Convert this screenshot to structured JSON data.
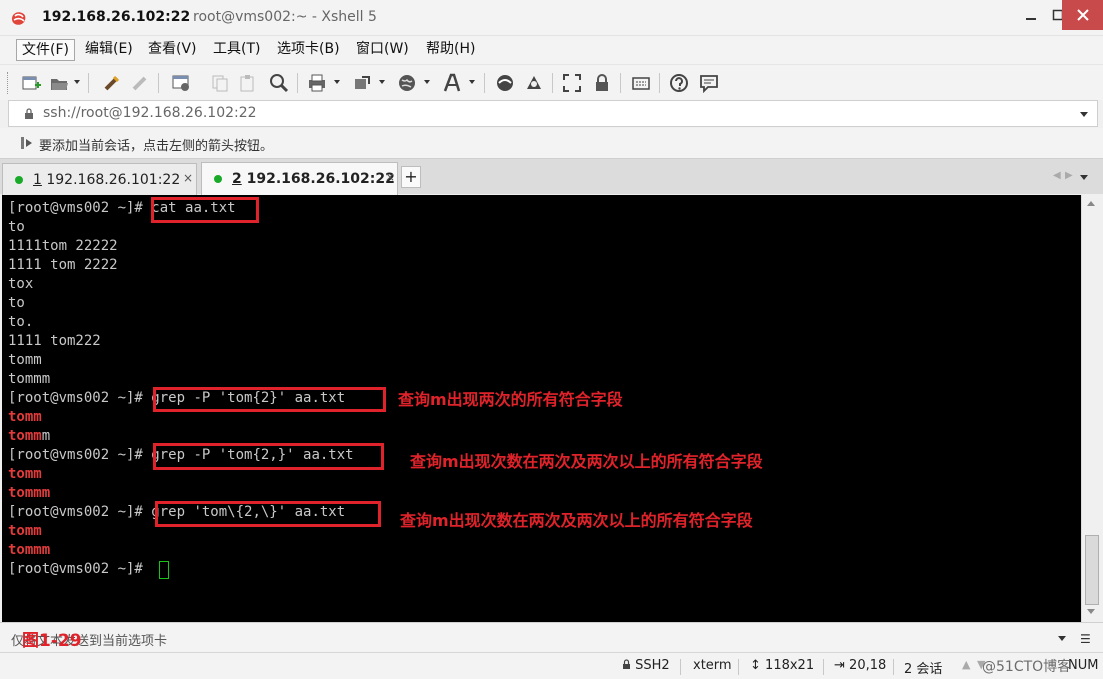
{
  "window": {
    "title_main": "192.168.26.102:22",
    "title_sub": "root@vms002:~ - Xshell 5"
  },
  "menu": [
    {
      "label": "文件(F)"
    },
    {
      "label": "编辑(E)"
    },
    {
      "label": "查看(V)"
    },
    {
      "label": "工具(T)"
    },
    {
      "label": "选项卡(B)"
    },
    {
      "label": "窗口(W)"
    },
    {
      "label": "帮助(H)"
    }
  ],
  "address": {
    "value": "ssh://root@192.168.26.102:22"
  },
  "session_hint": "要添加当前会话，点击左侧的箭头按钮。",
  "tabs": [
    {
      "num": "1",
      "label": " 192.168.26.101:22",
      "close": "×"
    },
    {
      "num": "2",
      "label": " 192.168.26.102:22",
      "close": "×"
    }
  ],
  "tab_add": "+",
  "terminal": {
    "lines": [
      {
        "prompt": "[root@vms002 ~]# ",
        "cmd": "cat aa.txt"
      },
      {
        "text": "to"
      },
      {
        "text": "1111tom 22222"
      },
      {
        "text": "1111 tom 2222"
      },
      {
        "text": "tox"
      },
      {
        "text": "to"
      },
      {
        "text": "to."
      },
      {
        "text": "1111 tom222"
      },
      {
        "text": "tomm"
      },
      {
        "text": "tommm"
      },
      {
        "prompt": "[root@vms002 ~]# ",
        "cmd": "grep -P 'tom{2}' aa.txt"
      },
      {
        "red": "tomm"
      },
      {
        "red": "tomm",
        "tail": "m"
      },
      {
        "prompt": "[root@vms002 ~]# ",
        "cmd": "grep -P 'tom{2,}' aa.txt"
      },
      {
        "red": "tomm"
      },
      {
        "red": "tommm"
      },
      {
        "prompt": "[root@vms002 ~]# ",
        "cmd": "grep 'tom\\{2,\\}' aa.txt"
      },
      {
        "red": "tomm"
      },
      {
        "red": "tommm"
      },
      {
        "prompt": "[root@vms002 ~]# ",
        "cmd": ""
      }
    ],
    "annotations": [
      "查询m出现两次的所有符合字段",
      "查询m出现次数在两次及两次以上的所有符合字段",
      "查询m出现次数在两次及两次以上的所有符合字段"
    ]
  },
  "input_bar": {
    "text": "仅将文本发送到当前选项卡",
    "figure_label": "图1-29"
  },
  "status": {
    "protocol": "SSH2",
    "term": "xterm",
    "size": "118x21",
    "cursor": "20,18",
    "sessions": "2 会话",
    "num": "NUM",
    "watermark": "@51CTO博客"
  },
  "colors": {
    "terminal_bg": "#000000",
    "terminal_fg": "#c8c8c8",
    "match_red": "#e23b3b",
    "highlight_red": "#e0222a",
    "cursor_green": "#19c419",
    "tab_dot_green": "#1aaa2a",
    "close_btn": "#c94a4a"
  }
}
